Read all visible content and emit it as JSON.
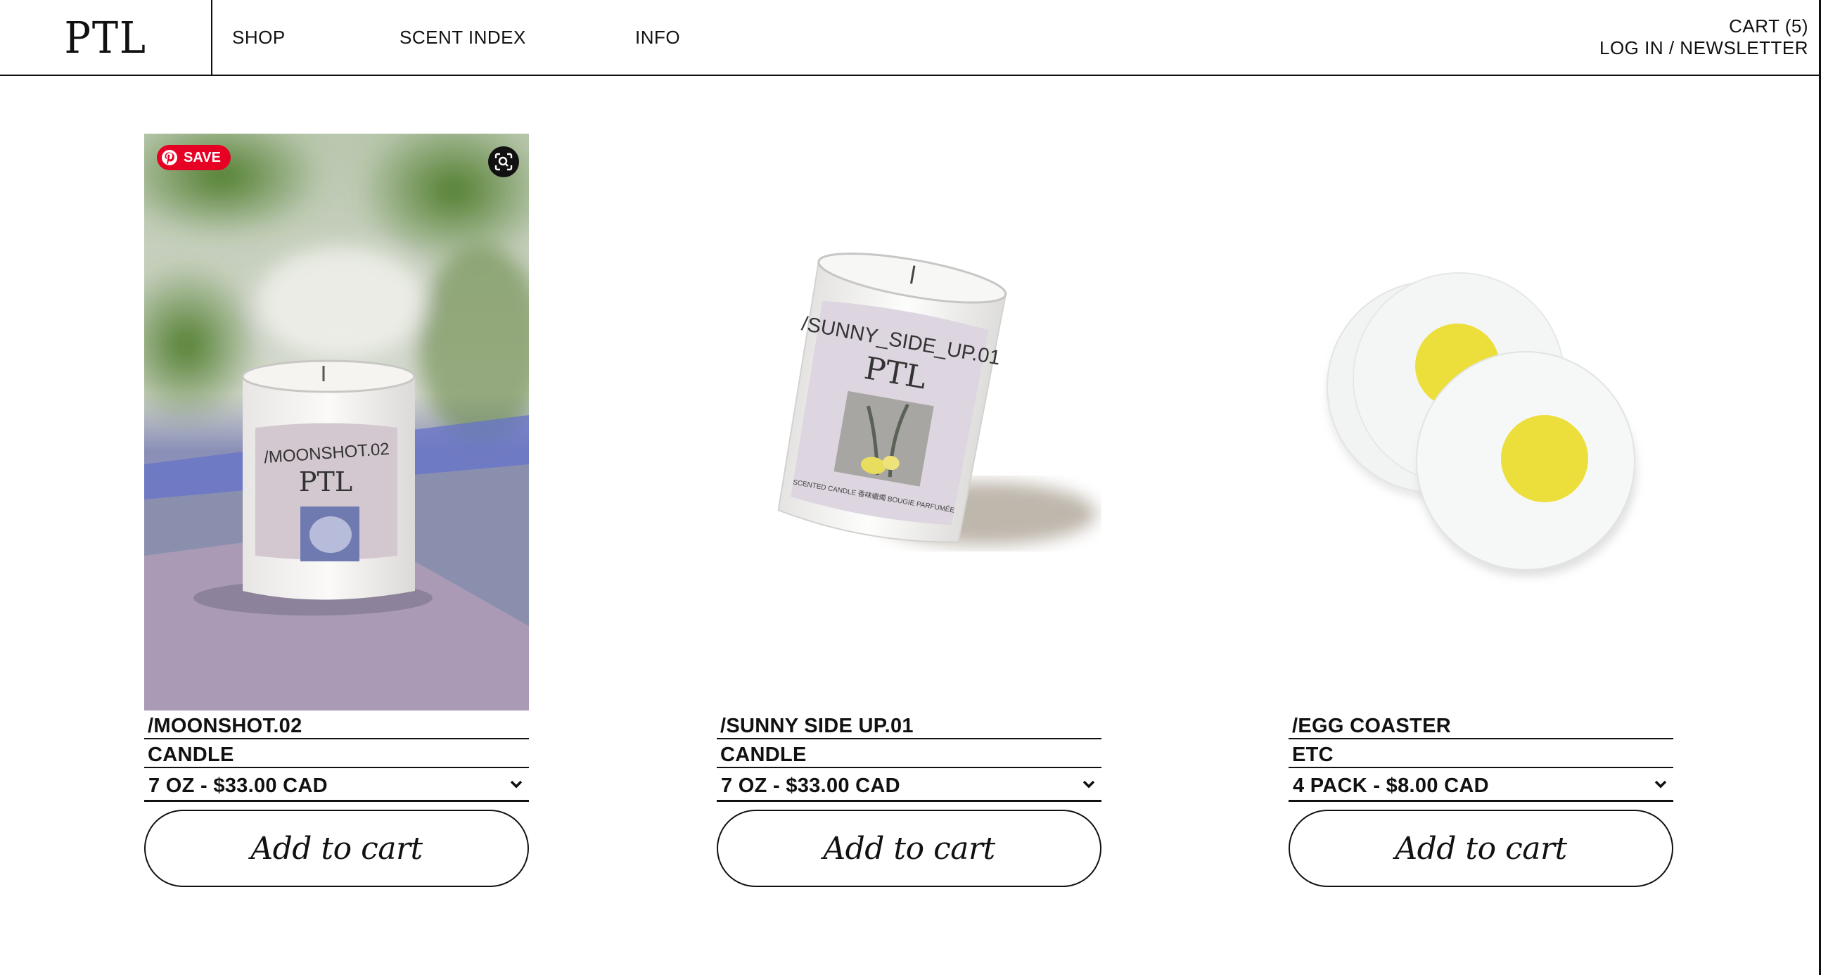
{
  "header": {
    "logo": "PTL",
    "nav": [
      "SHOP",
      "SCENT INDEX",
      "INFO"
    ],
    "cart_label": "CART (5)",
    "account_label": "LOG IN / NEWSLETTER"
  },
  "pinterest": {
    "save_label": "SAVE"
  },
  "products": [
    {
      "name": "/MOONSHOT.02",
      "type": "CANDLE",
      "variant": "7 OZ - $33.00 CAD",
      "button": "Add to cart",
      "label_title": "/MOONSHOT.02",
      "label_brand": "PTL"
    },
    {
      "name": "/SUNNY SIDE UP.01",
      "type": "CANDLE",
      "variant": "7 OZ - $33.00 CAD",
      "button": "Add to cart",
      "label_title": "/SUNNY_SIDE_UP.01",
      "label_brand": "PTL",
      "label_footer": "SCENTED CANDLE   香味蠟燭   BOUGIE PARFUMÉE"
    },
    {
      "name": "/EGG COASTER",
      "type": "ETC",
      "variant": "4 PACK - $8.00 CAD",
      "button": "Add to cart"
    }
  ],
  "colors": {
    "pinterest_red": "#e60023",
    "egg_yolk": "#ecdf3c",
    "border": "#111111"
  }
}
